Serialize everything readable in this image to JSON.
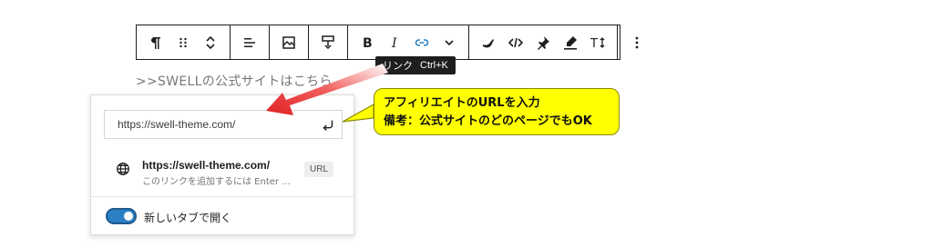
{
  "toolbar": {
    "groups": [
      [
        "pilcrow-icon",
        "drag-handle-icon",
        "move-updown-icon"
      ],
      [
        "align-left-icon"
      ],
      [
        "image-icon"
      ],
      [
        "format-icon"
      ],
      [
        "bold-icon",
        "italic-icon",
        "link-icon",
        "more-chevron-icon"
      ],
      [
        "highlighter-icon",
        "code-icon",
        "pin-icon",
        "marker-icon",
        "text-size-icon"
      ],
      [
        "options-icon"
      ]
    ]
  },
  "tooltip": {
    "label": "リンク",
    "shortcut": "Ctrl+K"
  },
  "paragraph": {
    "text": ">>SWELLの公式サイトはこちら"
  },
  "link_popover": {
    "input_value": "https://swell-theme.com/",
    "suggestion": {
      "url": "https://swell-theme.com/",
      "hint": "このリンクを追加するには Enter ...",
      "badge": "URL"
    },
    "toggle": {
      "label": "新しいタブで開く",
      "checked": true
    }
  },
  "annotation": {
    "line1": "アフィリエイトのURLを入力",
    "line2": "備考：公式サイトのどのページでもOK",
    "callout_color": "#ffff00",
    "arrow_color": "#e02020"
  },
  "colors": {
    "accent": "#2b80c4"
  }
}
